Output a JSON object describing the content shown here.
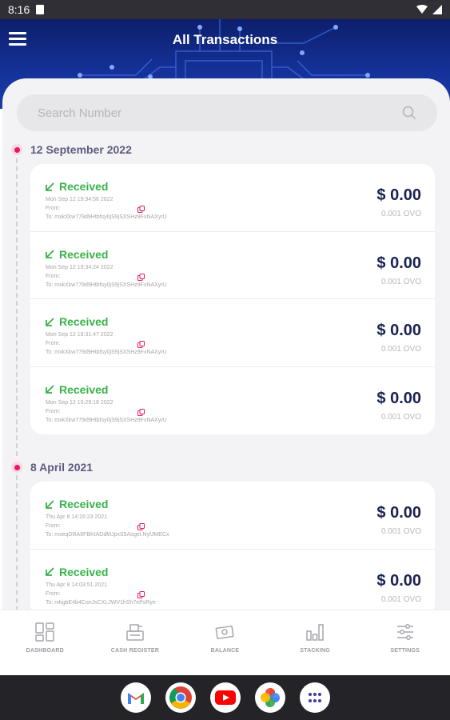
{
  "status_bar": {
    "time": "8:16"
  },
  "header": {
    "title": "All Transactions"
  },
  "search": {
    "placeholder": "Search Number"
  },
  "groups": [
    {
      "date": "12 September 2022",
      "transactions": [
        {
          "type": "Received",
          "date": "Mon Sep 12 19:34:56 2022",
          "from": "From:",
          "to": "To: mxkXkw779d9Htbfsy0jS9jSXSHz9FxNAXyrU",
          "amount": "$ 0.00",
          "coin": "0.001 OVO"
        },
        {
          "type": "Received",
          "date": "Mon Sep 12 19:34:24 2022",
          "from": "From:",
          "to": "To: mxkXkw779d9Htbfsy0jS9jSXSHz9FxNAXyrU",
          "amount": "$ 0.00",
          "coin": "0.001 OVO"
        },
        {
          "type": "Received",
          "date": "Mon Sep 12 19:31:47 2022",
          "from": "From:",
          "to": "To: mxkXkw779d9Htbfsy0jS9jSXSHz9FxNAXyrU",
          "amount": "$ 0.00",
          "coin": "0.001 OVO"
        },
        {
          "type": "Received",
          "date": "Mon Sep 12 19:29:18 2022",
          "from": "From:",
          "to": "To: mxkXkw779d9Htbfsy0jS9jSXSHz9FxNAXyrU",
          "amount": "$ 0.00",
          "coin": "0.001 OVO"
        }
      ]
    },
    {
      "date": "8 April 2021",
      "transactions": [
        {
          "type": "Received",
          "date": "Thu Apr 8 14:16:23 2021",
          "from": "From:",
          "to": "To: mxeqDRA9FBKtADdMJpxS5Aogel.NyfJMECx",
          "amount": "$ 0.00",
          "coin": "0.001 OVO"
        },
        {
          "type": "Received",
          "date": "Thu Apr 8 14:03:51 2021",
          "from": "From:",
          "to": "To: n4igbE4b4ConJsCXLJWV1hSh7ePsRye",
          "amount": "$ 0.00",
          "coin": "0.001 OVO"
        }
      ]
    }
  ],
  "bottom_nav": [
    {
      "label": "DASHBOARD",
      "icon": "dashboard-icon"
    },
    {
      "label": "CASH REGISTER",
      "icon": "cash-register-icon"
    },
    {
      "label": "BALANCE",
      "icon": "balance-icon"
    },
    {
      "label": "STACKING",
      "icon": "stacking-icon"
    },
    {
      "label": "SETTINGS",
      "icon": "settings-icon"
    }
  ],
  "system_apps": [
    {
      "icon": "gmail-icon"
    },
    {
      "icon": "chrome-icon"
    },
    {
      "icon": "youtube-icon"
    },
    {
      "icon": "photos-icon"
    },
    {
      "icon": "app-drawer-icon"
    }
  ],
  "colors": {
    "accent_received": "#38b24a",
    "amount": "#1a2252",
    "date_dot": "#e9185f",
    "header": "#15329a"
  }
}
